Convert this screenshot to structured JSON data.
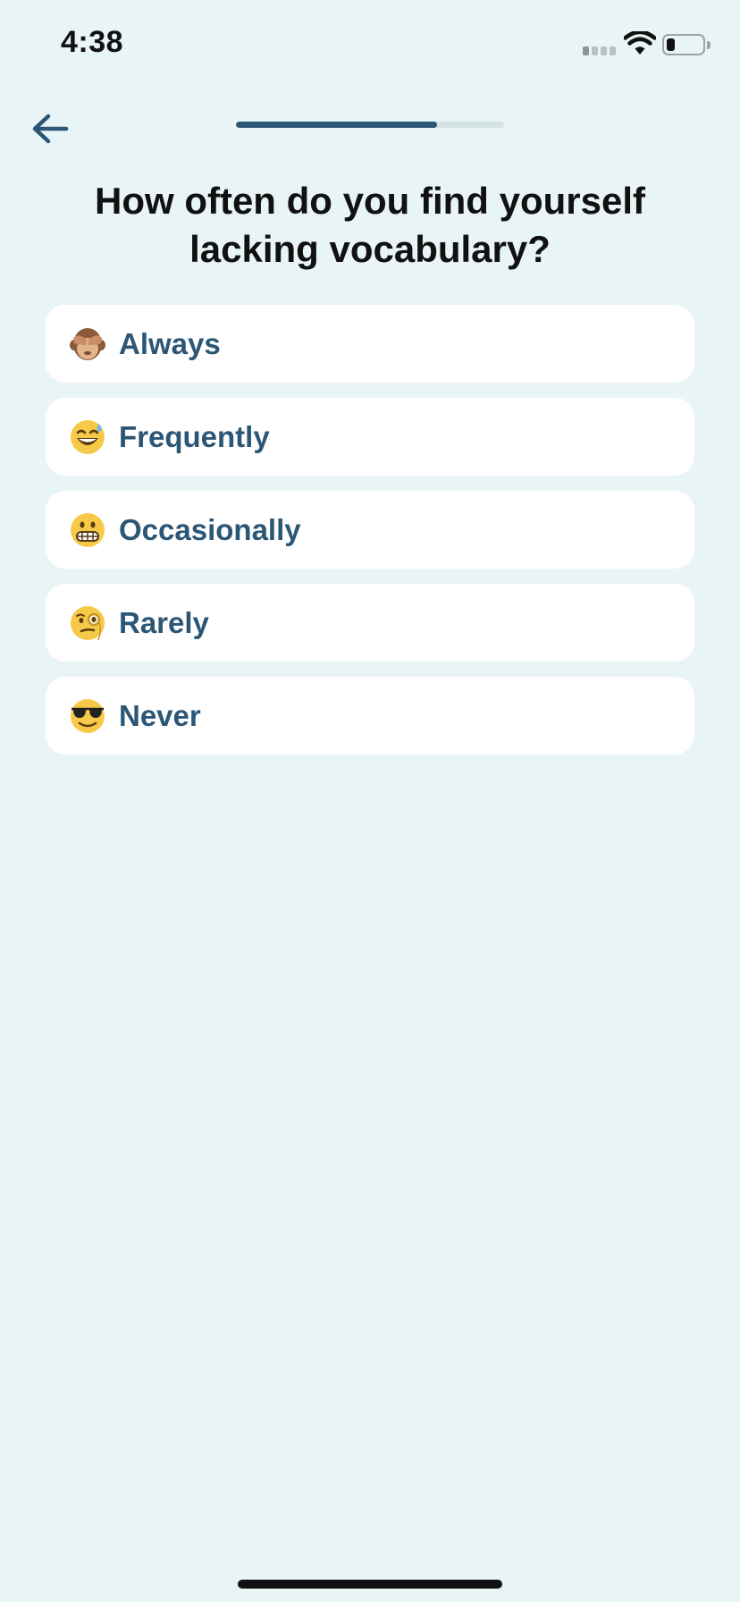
{
  "status_bar": {
    "time": "4:38",
    "signal_icon": "cellular-signal-icon",
    "wifi_icon": "wifi-icon",
    "battery_icon": "battery-icon",
    "battery_level": 0.25
  },
  "header": {
    "back_icon": "arrow-left-icon",
    "progress": 0.75
  },
  "question": {
    "title": "How often do you find yourself lacking vocabulary?"
  },
  "options": [
    {
      "emoji": "see-no-evil-monkey-icon",
      "label": "Always"
    },
    {
      "emoji": "grinning-sweat-face-icon",
      "label": "Frequently"
    },
    {
      "emoji": "grimacing-face-icon",
      "label": "Occasionally"
    },
    {
      "emoji": "monocle-face-icon",
      "label": "Rarely"
    },
    {
      "emoji": "sunglasses-face-icon",
      "label": "Never"
    }
  ],
  "colors": {
    "background": "#e9f4f6",
    "accent": "#2c5675",
    "card": "#ffffff",
    "track": "#d4e1e5"
  }
}
